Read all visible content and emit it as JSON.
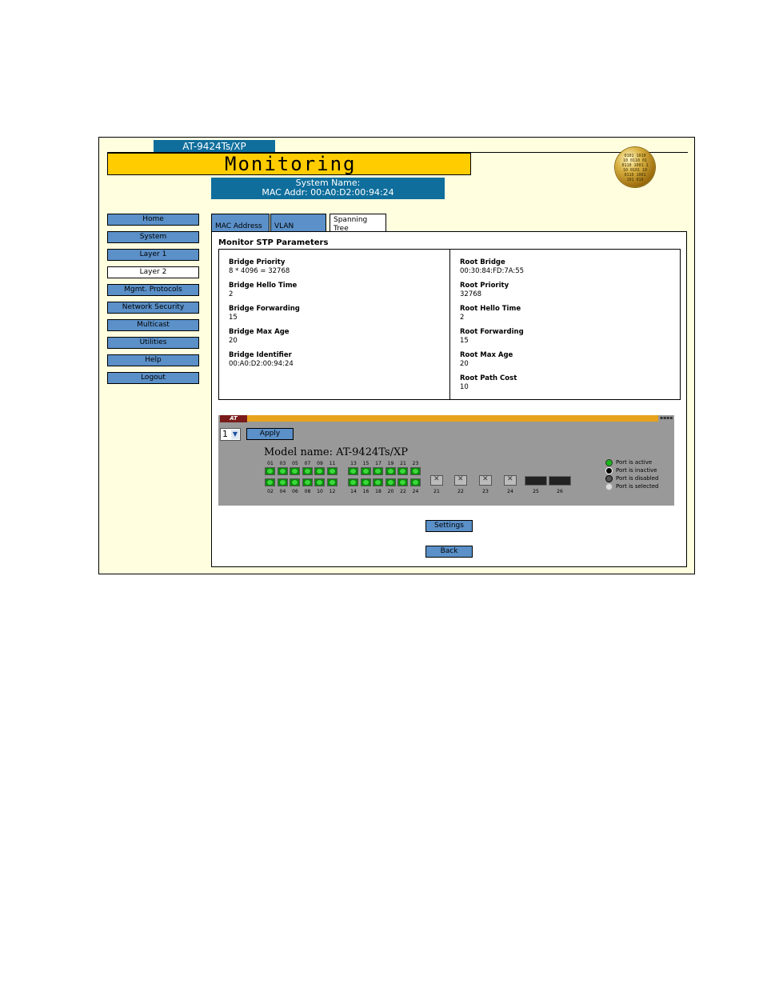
{
  "header": {
    "model_tab": "AT-9424Ts/XP",
    "title": "Monitoring",
    "system_name": "System Name:",
    "mac_addr": "MAC Addr: 00:A0:D2:00:94:24"
  },
  "sidebar": {
    "items": [
      {
        "label": "Home"
      },
      {
        "label": "System"
      },
      {
        "label": "Layer 1"
      },
      {
        "label": "Layer 2",
        "active": true
      },
      {
        "label": "Mgmt. Protocols"
      },
      {
        "label": "Network Security"
      },
      {
        "label": "Multicast"
      },
      {
        "label": "Utilities"
      },
      {
        "label": "Help"
      },
      {
        "label": "Logout"
      }
    ]
  },
  "tabs": [
    {
      "label": "MAC Address"
    },
    {
      "label": "VLAN"
    },
    {
      "label": "Spanning Tree",
      "active": true
    }
  ],
  "main": {
    "section_title": "Monitor STP Parameters",
    "bridge": [
      {
        "label": "Bridge Priority",
        "value": "8 * 4096 = 32768"
      },
      {
        "label": "Bridge Hello Time",
        "value": "2"
      },
      {
        "label": "Bridge Forwarding",
        "value": "15"
      },
      {
        "label": "Bridge Max Age",
        "value": "20"
      },
      {
        "label": "Bridge Identifier",
        "value": "00:A0:D2:00:94:24"
      }
    ],
    "root": [
      {
        "label": "Root Bridge",
        "value": "00:30:84:FD:7A:55"
      },
      {
        "label": "Root Priority",
        "value": "32768"
      },
      {
        "label": "Root Hello Time",
        "value": "2"
      },
      {
        "label": "Root Forwarding",
        "value": "15"
      },
      {
        "label": "Root Max Age",
        "value": "20"
      },
      {
        "label": "Root Path Cost",
        "value": "10"
      }
    ]
  },
  "switch_panel": {
    "unit_select": "1",
    "apply_label": "Apply",
    "model_name": "Model name: AT-9424Ts/XP",
    "top_ports": [
      "01",
      "03",
      "05",
      "07",
      "09",
      "11",
      "13",
      "15",
      "17",
      "19",
      "21",
      "23"
    ],
    "bottom_ports": [
      "02",
      "04",
      "06",
      "08",
      "10",
      "12",
      "14",
      "16",
      "18",
      "20",
      "22",
      "24"
    ],
    "gig_ports": [
      "21",
      "22",
      "23",
      "24"
    ],
    "fiber_ports": [
      "25",
      "26"
    ],
    "legend": [
      {
        "label": "Port is active",
        "color": "#18b818"
      },
      {
        "label": "Port is inactive",
        "color": "#000000"
      },
      {
        "label": "Port is disabled",
        "color": "#555555"
      },
      {
        "label": "Port is selected",
        "color": "#dddddd"
      }
    ]
  },
  "buttons": {
    "settings": "Settings",
    "back": "Back"
  },
  "colors": {
    "accent_blue": "#0f6e9c",
    "nav_blue": "#5b90c8",
    "title_yellow": "#ffcc00",
    "frame_bg": "#ffffe0"
  }
}
